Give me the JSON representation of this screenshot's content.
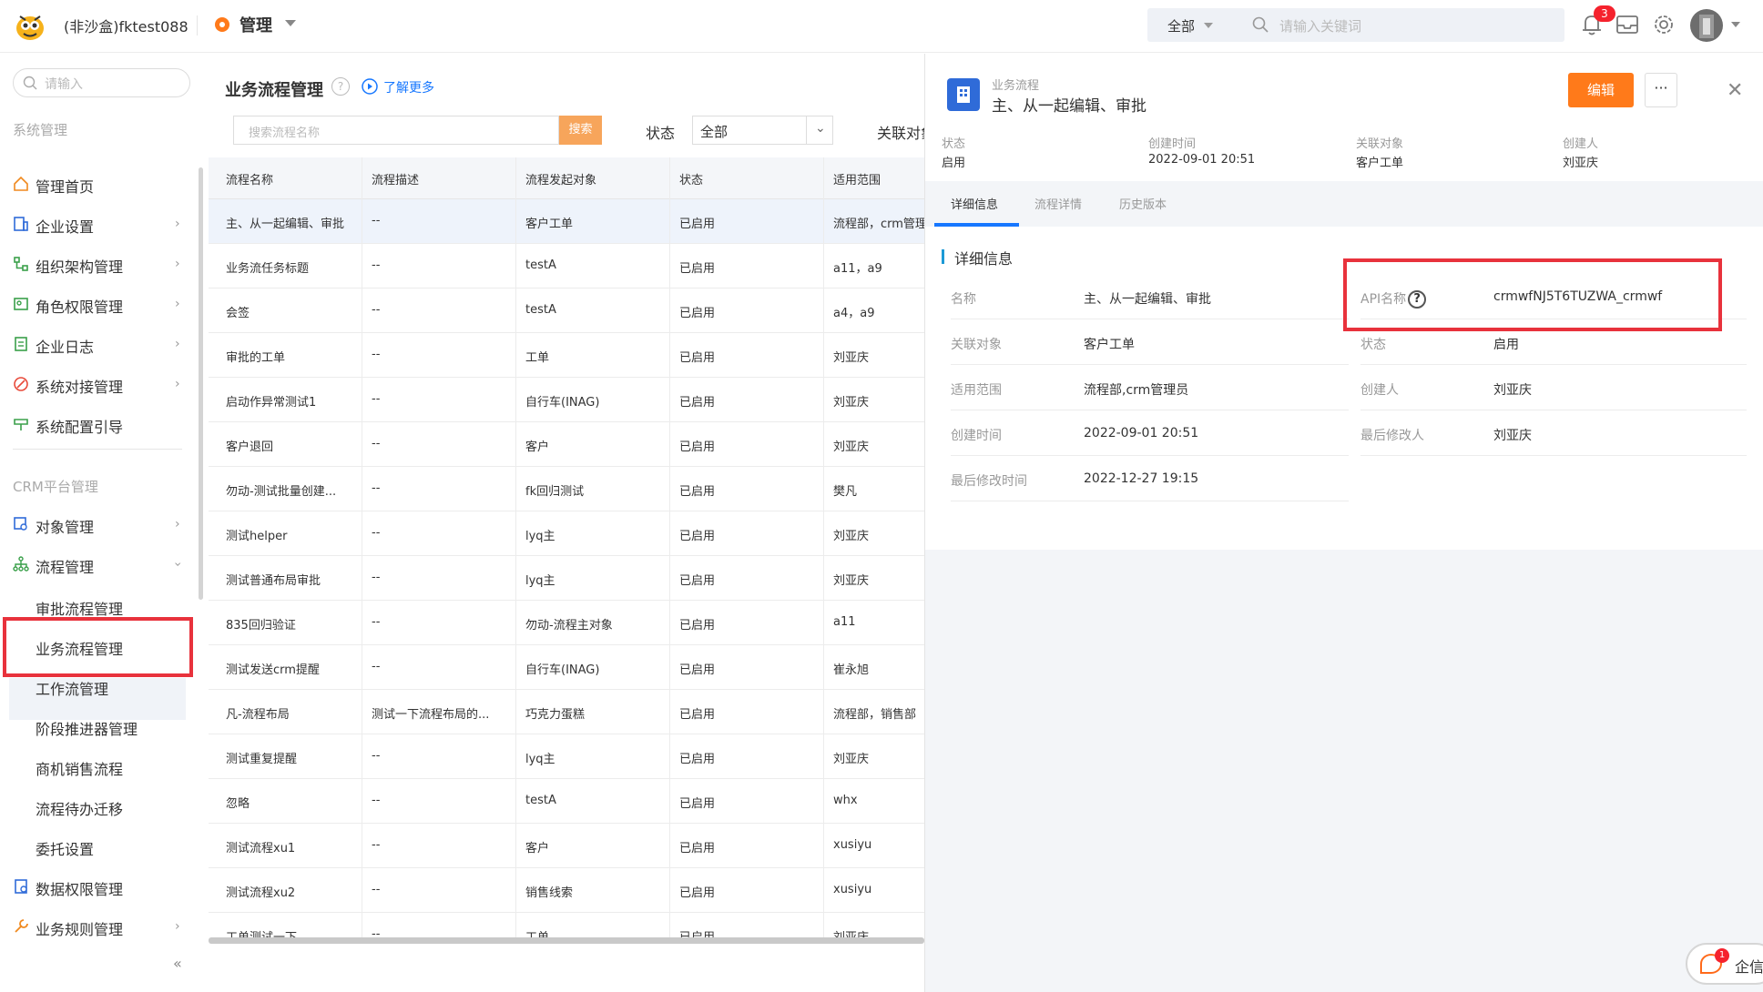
{
  "header": {
    "tenant": "(非沙盒)fktest088",
    "app_name": "管理",
    "search_scope": "全部",
    "search_placeholder": "请输入关键词",
    "notif_count": "3"
  },
  "sidebar": {
    "search_placeholder": "请输入",
    "section_system": "系统管理",
    "section_crm": "CRM平台管理",
    "system_items": [
      {
        "label": "管理首页",
        "icon": "home-icon"
      },
      {
        "label": "企业设置",
        "icon": "enterprise-icon"
      },
      {
        "label": "组织架构管理",
        "icon": "org-icon"
      },
      {
        "label": "角色权限管理",
        "icon": "role-icon"
      },
      {
        "label": "企业日志",
        "icon": "log-icon"
      },
      {
        "label": "系统对接管理",
        "icon": "integration-icon"
      },
      {
        "label": "系统配置引导",
        "icon": "guide-icon"
      }
    ],
    "crm_items": [
      {
        "label": "对象管理",
        "icon": "object-icon"
      },
      {
        "label": "流程管理",
        "icon": "flow-icon"
      }
    ],
    "flow_sub_items": [
      "审批流程管理",
      "业务流程管理",
      "工作流管理",
      "阶段推进器管理",
      "商机销售流程",
      "流程待办迁移",
      "委托设置"
    ],
    "tail_items": [
      {
        "label": "数据权限管理",
        "icon": "data-permission-icon"
      },
      {
        "label": "业务规则管理",
        "icon": "rule-icon"
      }
    ],
    "collapse_label": "«"
  },
  "main": {
    "title": "业务流程管理",
    "learn_more": "了解更多",
    "search_placeholder": "搜索流程名称",
    "search_button": "搜索",
    "status_label": "状态",
    "status_value": "全部",
    "related_label": "关联对象",
    "columns": [
      "流程名称",
      "流程描述",
      "流程发起对象",
      "状态",
      "适用范围"
    ],
    "rows": [
      [
        "主、从一起编辑、审批",
        "--",
        "客户工单",
        "已启用",
        "流程部，crm管理员"
      ],
      [
        "业务流任务标题",
        "--",
        "testA",
        "已启用",
        "a11，a9"
      ],
      [
        "会签",
        "--",
        "testA",
        "已启用",
        "a4，a9"
      ],
      [
        "审批的工单",
        "--",
        "工单",
        "已启用",
        "刘亚庆"
      ],
      [
        "启动作异常测试1",
        "--",
        "自行车(INAG)",
        "已启用",
        "刘亚庆"
      ],
      [
        "客户退回",
        "--",
        "客户",
        "已启用",
        "刘亚庆"
      ],
      [
        "勿动-测试批量创建...",
        "--",
        "fk回归测试",
        "已启用",
        "樊凡"
      ],
      [
        "测试helper",
        "--",
        "lyq主",
        "已启用",
        "刘亚庆"
      ],
      [
        "测试普通布局审批",
        "--",
        "lyq主",
        "已启用",
        "刘亚庆"
      ],
      [
        "835回归验证",
        "--",
        "勿动-流程主对象",
        "已启用",
        "a11"
      ],
      [
        "测试发送crm提醒",
        "--",
        "自行车(INAG)",
        "已启用",
        "崔永旭"
      ],
      [
        "凡-流程布局",
        "测试一下流程布局的...",
        "巧克力蛋糕",
        "已启用",
        "流程部，销售部"
      ],
      [
        "测试重复提醒",
        "--",
        "lyq主",
        "已启用",
        "刘亚庆"
      ],
      [
        "忽略",
        "--",
        "testA",
        "已启用",
        "whx"
      ],
      [
        "测试流程xu1",
        "--",
        "客户",
        "已启用",
        "xusiyu"
      ],
      [
        "测试流程xu2",
        "--",
        "销售线索",
        "已启用",
        "xusiyu"
      ],
      [
        "工单测试一下",
        "--",
        "工单",
        "已启用",
        "刘亚庆"
      ]
    ]
  },
  "detail": {
    "subtitle": "业务流程",
    "title": "主、从一起编辑、审批",
    "edit_button": "编辑",
    "more_button": "···",
    "close": "✕",
    "meta": [
      {
        "label": "状态",
        "value": "启用"
      },
      {
        "label": "创建时间",
        "value": "2022-09-01 20:51"
      },
      {
        "label": "关联对象",
        "value": "客户工单"
      },
      {
        "label": "创建人",
        "value": "刘亚庆"
      }
    ],
    "tabs": [
      "详细信息",
      "流程详情",
      "历史版本"
    ],
    "section_title": "详细信息",
    "left_fields": [
      {
        "label": "名称",
        "value": "主、从一起编辑、审批"
      },
      {
        "label": "关联对象",
        "value": "客户工单"
      },
      {
        "label": "适用范围",
        "value": "流程部,crm管理员"
      },
      {
        "label": "创建时间",
        "value": "2022-09-01 20:51"
      },
      {
        "label": "最后修改时间",
        "value": "2022-12-27 19:15"
      }
    ],
    "right_fields": [
      {
        "label": "API名称",
        "value": "crmwfNJ5T6TUZWA_crmwf"
      },
      {
        "label": "状态",
        "value": "启用"
      },
      {
        "label": "创建人",
        "value": "刘亚庆"
      },
      {
        "label": "最后修改人",
        "value": "刘亚庆"
      }
    ]
  },
  "chat": {
    "label": "企信",
    "badge": "1"
  },
  "colors": {
    "accent": "#ff7a1a",
    "link": "#1677ff",
    "highlight": "#e8323c"
  }
}
